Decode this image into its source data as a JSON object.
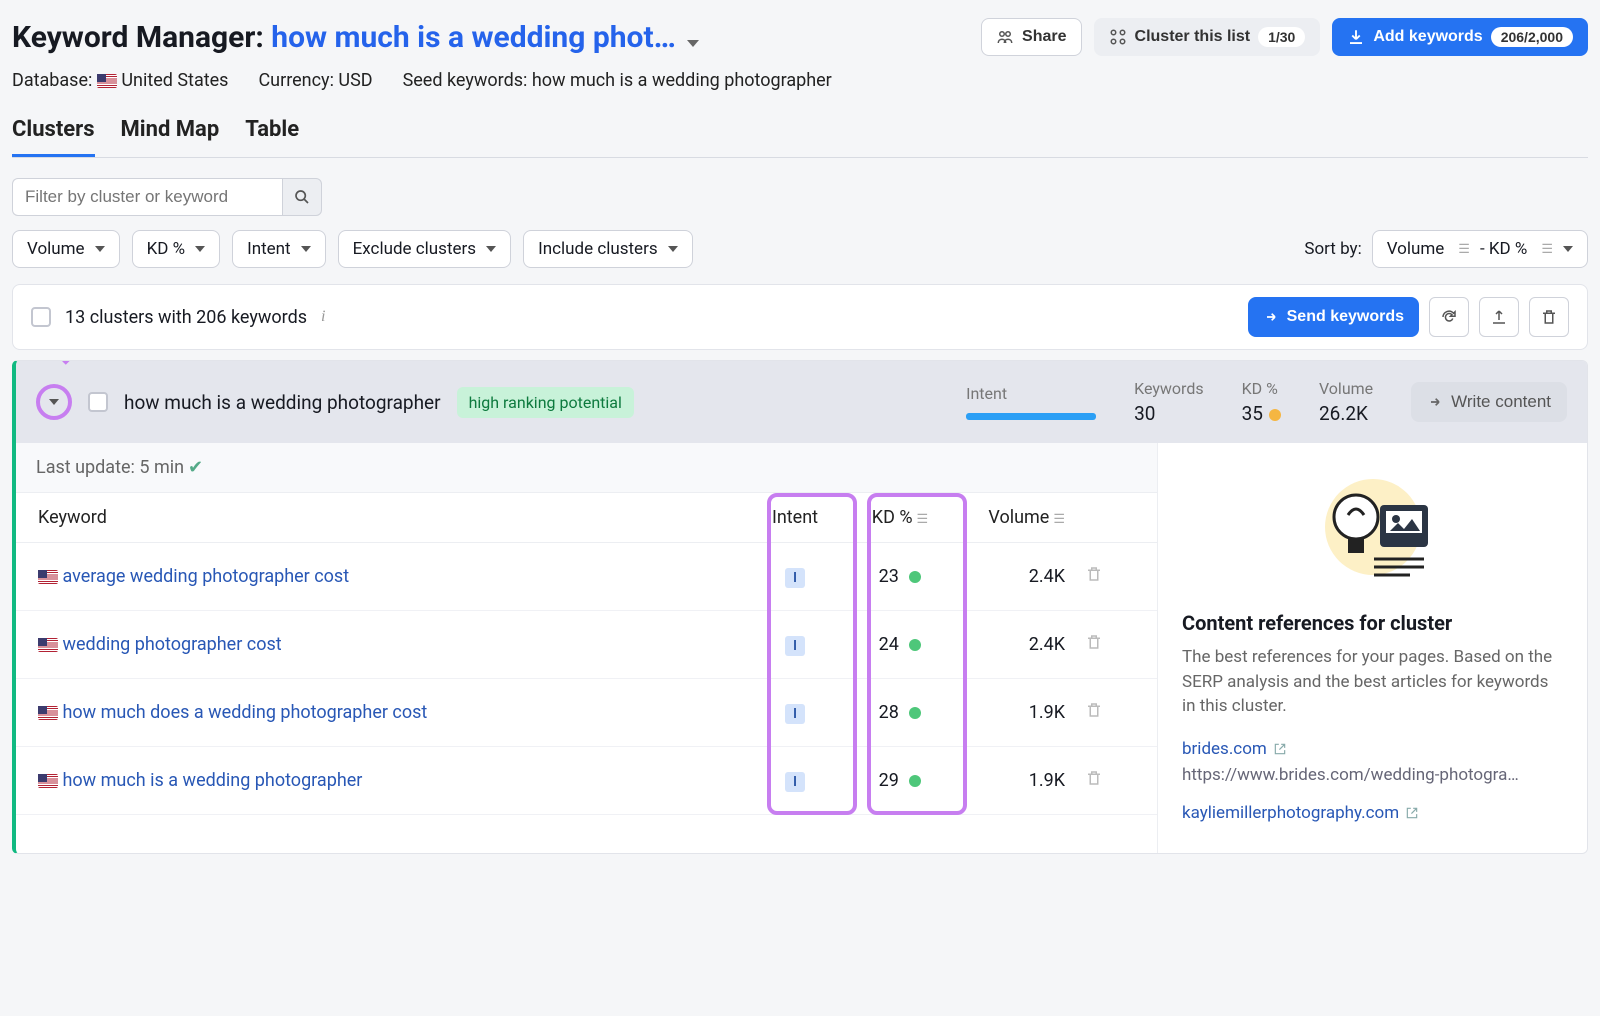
{
  "header": {
    "prefix": "Keyword Manager:",
    "listName": "how much is a wedding phot…",
    "share": "Share",
    "clusterList": "Cluster this list",
    "clusterBadge": "1/30",
    "addKw": "Add keywords",
    "addKwBadge": "206/2,000"
  },
  "meta": {
    "databaseLabel": "Database:",
    "database": "United States",
    "currencyLabel": "Currency:",
    "currency": "USD",
    "seedLabel": "Seed keywords:",
    "seed": "how much is a wedding photographer"
  },
  "tabs": {
    "clusters": "Clusters",
    "mindmap": "Mind Map",
    "table": "Table"
  },
  "filter": {
    "placeholder": "Filter by cluster or keyword",
    "volume": "Volume",
    "kd": "KD %",
    "intent": "Intent",
    "exclude": "Exclude clusters",
    "include": "Include clusters",
    "sortBy": "Sort by:",
    "sortValue": "Volume"
  },
  "sortKd": "- KD %",
  "toolbar": {
    "summary": "13 clusters with 206 keywords",
    "send": "Send keywords"
  },
  "cluster": {
    "name": "how much is a wedding photographer",
    "badge": "high ranking potential",
    "intentLbl": "Intent",
    "keywordsLbl": "Keywords",
    "keywords": "30",
    "kdLbl": "KD %",
    "kd": "35",
    "volLbl": "Volume",
    "vol": "26.2K",
    "write": "Write content",
    "lastUpdate": "Last update: 5 min"
  },
  "cols": {
    "keyword": "Keyword",
    "intent": "Intent",
    "kd": "KD %",
    "volume": "Volume"
  },
  "rows": [
    {
      "kw": "average wedding photographer cost",
      "intent": "I",
      "kd": "23",
      "vol": "2.4K"
    },
    {
      "kw": "wedding photographer cost",
      "intent": "I",
      "kd": "24",
      "vol": "2.4K"
    },
    {
      "kw": "how much does a wedding photographer cost",
      "intent": "I",
      "kd": "28",
      "vol": "1.9K"
    },
    {
      "kw": "how much is a wedding photographer",
      "intent": "I",
      "kd": "29",
      "vol": "1.9K"
    }
  ],
  "side": {
    "title": "Content references for cluster",
    "desc": "The best references for your pages. Based on the SERP analysis and the best articles for keywords in this cluster.",
    "ref1": "brides.com",
    "ref1url": "https://www.brides.com/wedding-photogra…",
    "ref2": "kayliemillerphotography.com"
  }
}
